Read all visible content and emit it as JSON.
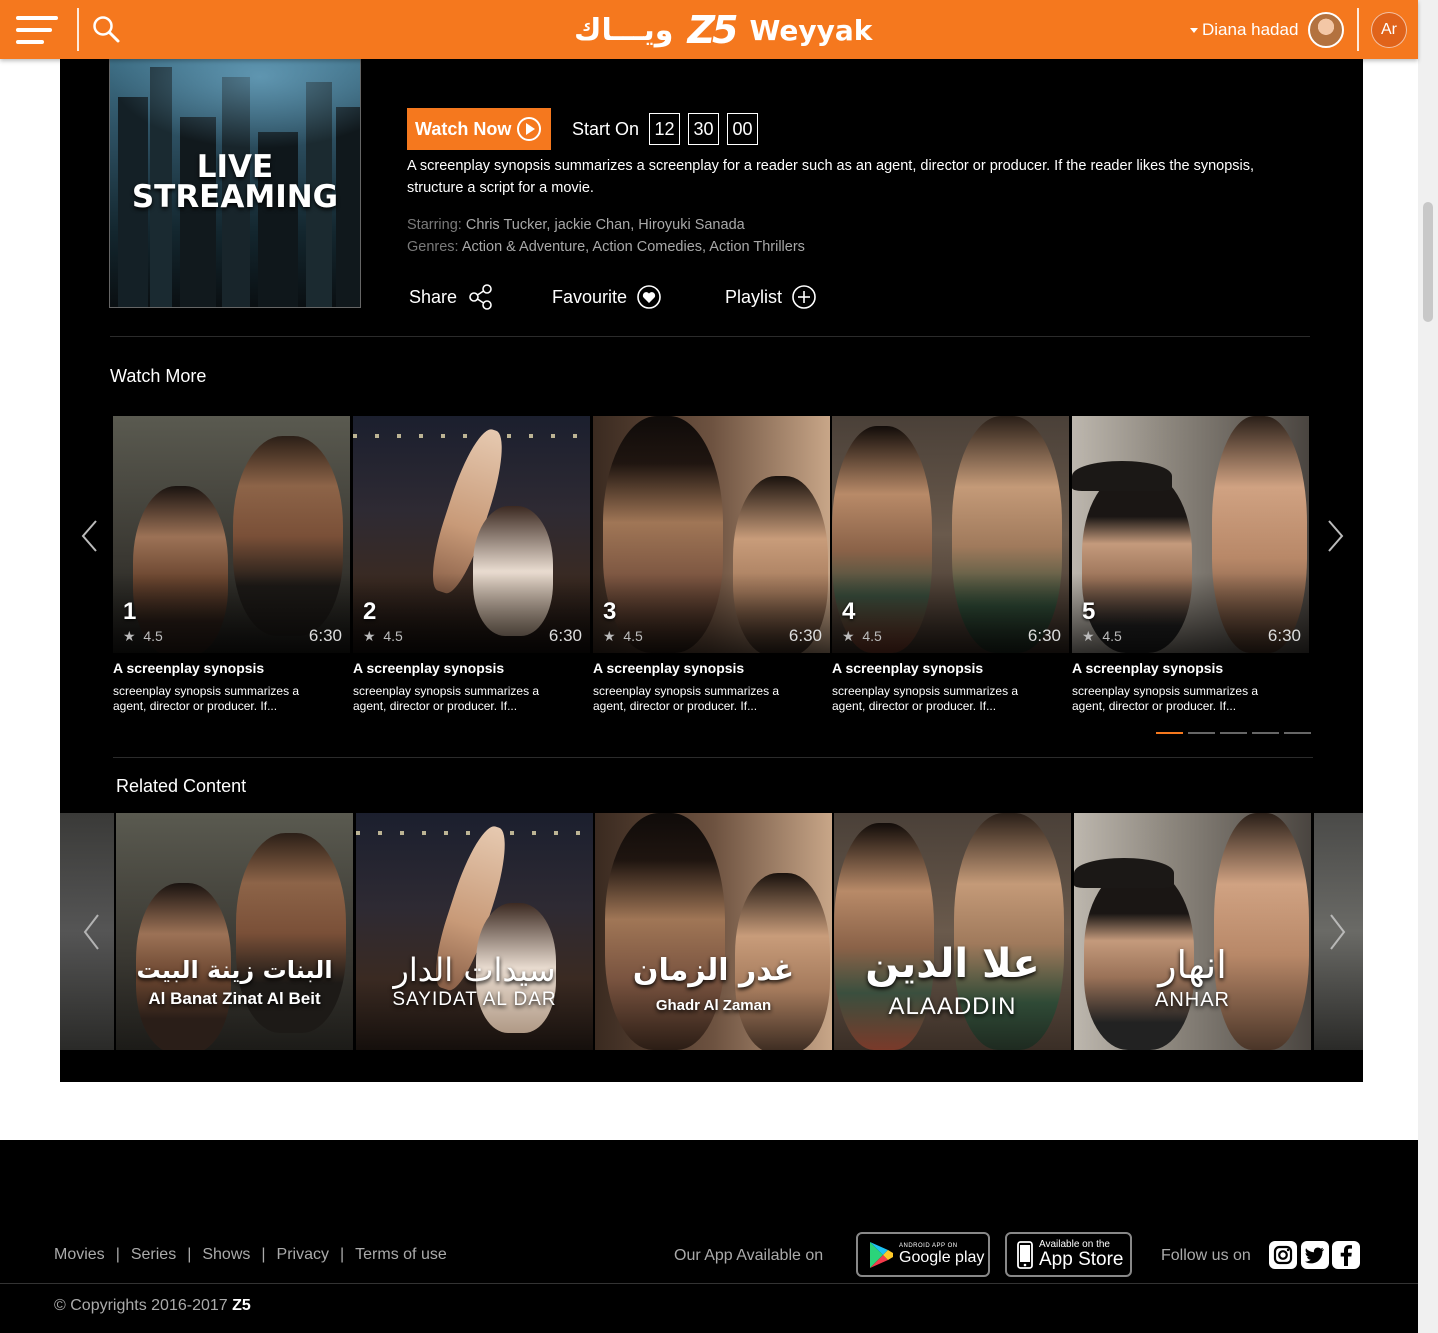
{
  "header": {
    "logo_arabic": "ويـــاك",
    "logo_mark": "Z5",
    "logo_english": "Weyyak",
    "user_name": "Diana hadad",
    "language": "Ar"
  },
  "detail": {
    "poster_line1": "LIVE",
    "poster_line2": "STREAMING",
    "watch_now": "Watch Now",
    "start_on_label": "Start On",
    "hours": "12",
    "minutes": "30",
    "seconds": "00",
    "synopsis": "A screenplay synopsis summarizes a screenplay for a reader such as an agent, director or producer. If the reader likes the synopsis, structure a script for a movie.",
    "starring_label": "Starring:",
    "starring": "Chris Tucker, jackie Chan, Hiroyuki Sanada",
    "genres_label": "Genres:",
    "genres": "Action & Adventure, Action Comedies, Action Thrillers",
    "share": "Share",
    "favourite": "Favourite",
    "playlist": "Playlist"
  },
  "watch_more": {
    "title": "Watch More",
    "items": [
      {
        "num": "1",
        "rating": "4.5",
        "duration": "6:30",
        "title": "A screenplay synopsis",
        "desc": "screenplay synopsis summarizes a agent, director or producer. If..."
      },
      {
        "num": "2",
        "rating": "4.5",
        "duration": "6:30",
        "title": "A screenplay synopsis",
        "desc": "screenplay synopsis summarizes a agent, director or producer. If..."
      },
      {
        "num": "3",
        "rating": "4.5",
        "duration": "6:30",
        "title": "A screenplay synopsis",
        "desc": "screenplay synopsis summarizes a agent, director or producer. If..."
      },
      {
        "num": "4",
        "rating": "4.5",
        "duration": "6:30",
        "title": "A screenplay synopsis",
        "desc": "screenplay synopsis summarizes a agent, director or producer. If..."
      },
      {
        "num": "5",
        "rating": "4.5",
        "duration": "6:30",
        "title": "A screenplay synopsis",
        "desc": "screenplay synopsis summarizes a agent, director or producer. If..."
      }
    ],
    "pages": 5,
    "active_page": 1
  },
  "related": {
    "title": "Related Content",
    "items": [
      {
        "ar": "البنات زينة البيت",
        "en": "Al Banat Zinat Al Beit"
      },
      {
        "ar": "سيدات الدار",
        "en": "SAYIDAT AL DAR"
      },
      {
        "ar": "غدر الزمان",
        "en": "Ghadr Al Zaman"
      },
      {
        "ar": "علا الدين",
        "en": "ALAADDIN"
      },
      {
        "ar": "انهار",
        "en": "ANHAR"
      }
    ]
  },
  "footer": {
    "links": [
      "Movies",
      "Series",
      "Shows",
      "Privacy",
      "Terms of use"
    ],
    "app_label": "Our App Available on",
    "google_small": "ANDROID APP ON",
    "google_big": "Google play",
    "apple_small": "Available on the",
    "apple_big": "App Store",
    "follow_label": "Follow us on",
    "copyright": "© Copyrights 2016-2017",
    "copyright_brand": "Z5"
  },
  "colors": {
    "accent": "#f5781e",
    "panel": "#000000",
    "footer": "#000000"
  }
}
